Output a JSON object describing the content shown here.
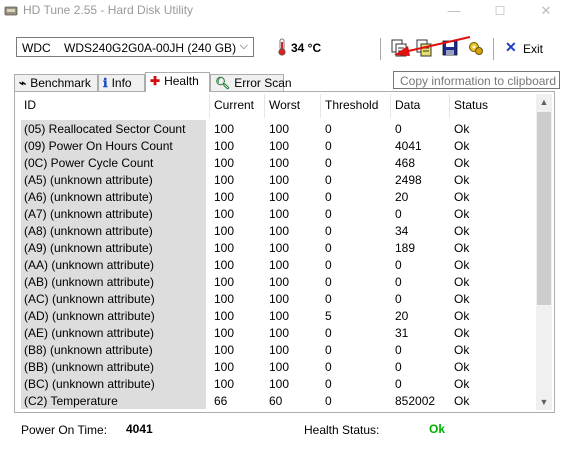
{
  "window": {
    "title": "HD Tune 2.55 - Hard Disk Utility",
    "minimize": "—",
    "maximize": "☐",
    "close": "✕"
  },
  "toolbar": {
    "drive": "WDC    WDS240G2G0A-00JH (240 GB)",
    "temperature": "34 °C",
    "exit_label": "Exit",
    "tooltip": "Copy information to clipboard"
  },
  "tabs": [
    {
      "label": "Benchmark",
      "icon": "benchmark-icon"
    },
    {
      "label": "Info",
      "icon": "info-icon"
    },
    {
      "label": "Health",
      "icon": "health-cross-icon"
    },
    {
      "label": "Error Scan",
      "icon": "magnifier-icon"
    }
  ],
  "table": {
    "columns": [
      "ID",
      "Current",
      "Worst",
      "Threshold",
      "Data",
      "Status"
    ],
    "rows": [
      [
        "(05) Reallocated Sector Count",
        "100",
        "100",
        "0",
        "0",
        "Ok"
      ],
      [
        "(09) Power On Hours Count",
        "100",
        "100",
        "0",
        "4041",
        "Ok"
      ],
      [
        "(0C) Power Cycle Count",
        "100",
        "100",
        "0",
        "468",
        "Ok"
      ],
      [
        "(A5) (unknown attribute)",
        "100",
        "100",
        "0",
        "2498",
        "Ok"
      ],
      [
        "(A6) (unknown attribute)",
        "100",
        "100",
        "0",
        "20",
        "Ok"
      ],
      [
        "(A7) (unknown attribute)",
        "100",
        "100",
        "0",
        "0",
        "Ok"
      ],
      [
        "(A8) (unknown attribute)",
        "100",
        "100",
        "0",
        "34",
        "Ok"
      ],
      [
        "(A9) (unknown attribute)",
        "100",
        "100",
        "0",
        "189",
        "Ok"
      ],
      [
        "(AA) (unknown attribute)",
        "100",
        "100",
        "0",
        "0",
        "Ok"
      ],
      [
        "(AB) (unknown attribute)",
        "100",
        "100",
        "0",
        "0",
        "Ok"
      ],
      [
        "(AC) (unknown attribute)",
        "100",
        "100",
        "0",
        "0",
        "Ok"
      ],
      [
        "(AD) (unknown attribute)",
        "100",
        "100",
        "5",
        "20",
        "Ok"
      ],
      [
        "(AE) (unknown attribute)",
        "100",
        "100",
        "0",
        "31",
        "Ok"
      ],
      [
        "(B8) (unknown attribute)",
        "100",
        "100",
        "0",
        "0",
        "Ok"
      ],
      [
        "(BB) (unknown attribute)",
        "100",
        "100",
        "0",
        "0",
        "Ok"
      ],
      [
        "(BC) (unknown attribute)",
        "100",
        "100",
        "0",
        "0",
        "Ok"
      ],
      [
        "(C2) Temperature",
        "66",
        "60",
        "0",
        "852002",
        "Ok"
      ]
    ]
  },
  "footer": {
    "power_on_label": "Power On Time:",
    "power_on_value": "4041",
    "health_label": "Health Status:",
    "health_value": "Ok",
    "health_color": "#00b000"
  },
  "colors": {
    "arrow": "#e01010",
    "exit_x": "#1a3fc8"
  }
}
